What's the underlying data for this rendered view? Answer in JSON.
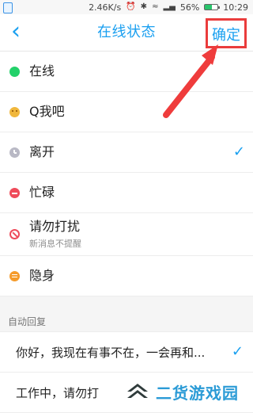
{
  "status_bar": {
    "speed": "2.46K/s",
    "battery": "56%",
    "time": "10:29",
    "icons": [
      "alarm-icon",
      "bluetooth-icon",
      "wifi-icon",
      "signal-icon",
      "battery-icon"
    ]
  },
  "header": {
    "title": "在线状态",
    "confirm_label": "确定",
    "back_icon": "chevron-left-icon"
  },
  "statuses": [
    {
      "label": "在线",
      "subtitle": "",
      "icon": "online-status-icon",
      "color": "#23d16a",
      "selected": false
    },
    {
      "label": "Q我吧",
      "subtitle": "",
      "icon": "q-me-status-icon",
      "color": "#f0b73c",
      "selected": false
    },
    {
      "label": "离开",
      "subtitle": "",
      "icon": "away-status-icon",
      "color": "#b9b9c5",
      "selected": true
    },
    {
      "label": "忙碌",
      "subtitle": "",
      "icon": "busy-status-icon",
      "color": "#ef4b5a",
      "selected": false
    },
    {
      "label": "请勿打扰",
      "subtitle": "新消息不提醒",
      "icon": "do-not-disturb-icon",
      "color": "#ee4b5b",
      "selected": false
    },
    {
      "label": "隐身",
      "subtitle": "",
      "icon": "invisible-status-icon",
      "color": "#f59b2b",
      "selected": false
    }
  ],
  "auto_reply": {
    "section_label": "自动回复",
    "items": [
      {
        "text": "你好，我现在有事不在，一会再和...",
        "selected": true
      },
      {
        "text": "工作中，请勿打",
        "selected": false
      }
    ]
  },
  "watermark": {
    "text": "二货游戏园"
  },
  "colors": {
    "accent": "#1aa0f0",
    "highlight": "#ea3c3c"
  }
}
